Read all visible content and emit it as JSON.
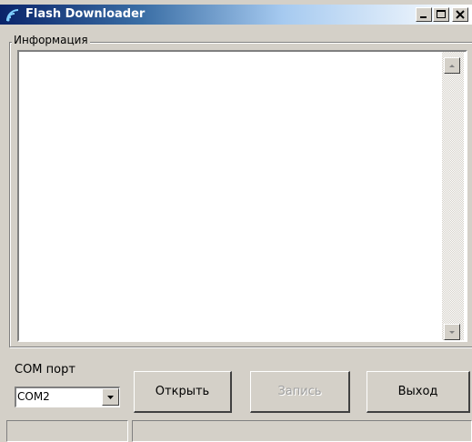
{
  "window": {
    "title": "Flash Downloader",
    "title_colors": {
      "active_start": "#0a246a",
      "active_end": "#ffffff"
    }
  },
  "caption_buttons": {
    "minimize_icon": "minimize-icon",
    "maximize_icon": "maximize-icon",
    "close_icon": "close-icon"
  },
  "info_group": {
    "label": "Информация",
    "log_text": ""
  },
  "com_port": {
    "label": "COM порт",
    "selected": "COM2"
  },
  "buttons": {
    "open": "Открыть",
    "write": "Запись",
    "exit": "Выход"
  },
  "status_bar": {
    "panel1": "",
    "panel2": ""
  },
  "colors": {
    "face": "#d4d0c8",
    "disabled_text": "#a0a0a0"
  }
}
